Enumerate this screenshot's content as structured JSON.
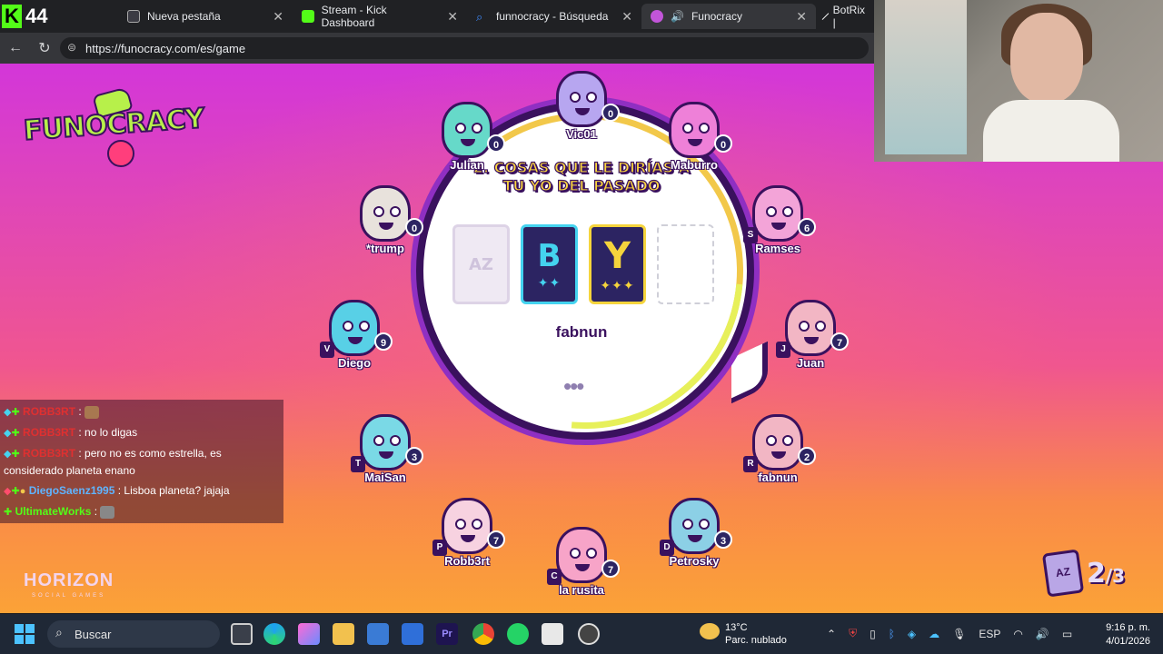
{
  "browser": {
    "kick_count": "44",
    "tabs": [
      {
        "title": "Nueva pestaña",
        "color": "#7a7adf"
      },
      {
        "title": "Stream - Kick Dashboard",
        "color": "#53fc18"
      },
      {
        "title": "funnocracy - Búsqueda",
        "color": "#3e8cff"
      },
      {
        "title": "Funocracy",
        "color": "#c255d9"
      },
      {
        "title": "BotRix |",
        "color": "#ffffff"
      }
    ],
    "url": "https://funocracy.com/es/game"
  },
  "game": {
    "logo": "FUNOCRACY",
    "question": "2. COSAS QUE LE DIRÍAS A TU YO DEL PASADO",
    "letters": [
      {
        "letter": "AZ",
        "stars": ""
      },
      {
        "letter": "B",
        "stars": "✦✦"
      },
      {
        "letter": "Y",
        "stars": "✦✦✦"
      },
      {
        "letter": "",
        "stars": ""
      }
    ],
    "current_player": "fabnun",
    "dots": "•••",
    "round": {
      "current": "2",
      "total": "/3",
      "card": "AZ"
    },
    "studio": "HORIZON",
    "studio_sub": "SOCIAL GAMES",
    "players": [
      {
        "name": "Vic01",
        "score": "0",
        "badge": "",
        "color": "#b7a6f0"
      },
      {
        "name": "Julian",
        "score": "0",
        "badge": "",
        "color": "#66d9c9"
      },
      {
        "name": "Maburro",
        "score": "0",
        "badge": "",
        "color": "#ee80d8"
      },
      {
        "name": "*trump",
        "score": "0",
        "badge": "",
        "color": "#e8e2dc"
      },
      {
        "name": "Ramses",
        "score": "6",
        "badge": "S",
        "color": "#f3a4d8"
      },
      {
        "name": "Diego",
        "score": "9",
        "badge": "V",
        "color": "#58d0e6"
      },
      {
        "name": "Juan",
        "score": "7",
        "badge": "J",
        "color": "#f2b6c4"
      },
      {
        "name": "MaiSan",
        "score": "3",
        "badge": "T",
        "color": "#7ad9e6"
      },
      {
        "name": "fabnun",
        "score": "2",
        "badge": "R",
        "color": "#f2b6c4"
      },
      {
        "name": "Robb3rt",
        "score": "7",
        "badge": "P",
        "color": "#f7d2e0"
      },
      {
        "name": "Petrosky",
        "score": "3",
        "badge": "D",
        "color": "#8cd0e6"
      },
      {
        "name": "la rusita",
        "score": "7",
        "badge": "C",
        "color": "#f7a4c8"
      }
    ]
  },
  "chat": [
    {
      "user": "ROBB3RT",
      "text": ":",
      "emote": true
    },
    {
      "user": "ROBB3RT",
      "text": ": no lo digas",
      "emote": false
    },
    {
      "user": "ROBB3RT",
      "text": ": pero no es como estrella, es considerado planeta enano",
      "emote": false
    },
    {
      "user": "DiegoSaenz1995",
      "text": ": Lisboa planeta? jajaja",
      "emote": false
    },
    {
      "user": "UltimateWorks",
      "text": ":",
      "emote": true
    }
  ],
  "taskbar": {
    "search_placeholder": "Buscar",
    "weather_temp": "13°C",
    "weather_desc": "Parc. nublado",
    "weather_badge": "2",
    "language": "ESP",
    "time": "9:16 p. m.",
    "date": "4/01/2026"
  }
}
